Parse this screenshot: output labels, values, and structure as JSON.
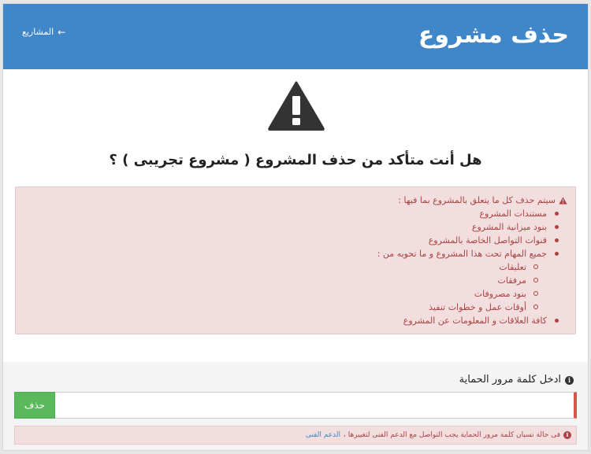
{
  "header": {
    "title": "حذف مشروع",
    "back_label": "المشاريع",
    "back_icon": "arrow-left-icon",
    "background": "#3f87c8"
  },
  "confirm": {
    "icon": "warning-icon",
    "question": "هل أنت متأكد من حذف المشروع ( مشروع تجريبى ) ؟"
  },
  "alert": {
    "icon": "warning-triangle-icon",
    "lead": "سيتم حذف كل ما يتعلق بالمشروع بما فيها :",
    "items": [
      "مستندات المشروع",
      "بنود ميزانية المشروع",
      "قنوات التواصل الخاصة بالمشروع",
      "جميع المهام تحت هذا المشروع و ما تحويه من :"
    ],
    "sub_items": [
      "تعليقات",
      "مرفقات",
      "بنود مصروفات",
      "أوقات عمل و خطوات تنفيذ"
    ],
    "last_item": "كافة العلاقات و المعلومات عن المشروع",
    "color": "#a94442",
    "background": "#f2dede"
  },
  "password": {
    "label": "ادخل كلمة مرور الحماية",
    "label_icon": "info-icon",
    "value": "",
    "button_label": "حذف",
    "button_color": "#5cb85c"
  },
  "help": {
    "icon": "info-icon",
    "text": "فى حالة نسيان كلمة مرور الحماية يجب التواصل مع الدعم الفنى لتغييرها ،",
    "link": "الدعم الفنى"
  }
}
